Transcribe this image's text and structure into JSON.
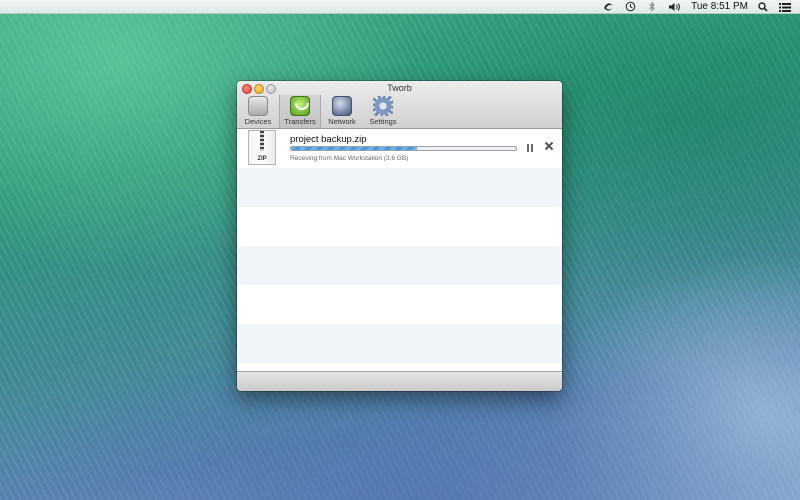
{
  "menubar": {
    "clock": "Tue 8:51 PM",
    "status_icons": [
      "tworb-icon",
      "time-machine-icon",
      "bluetooth-icon",
      "volume-icon"
    ],
    "right_icons": [
      "spotlight-icon",
      "notification-center-icon"
    ]
  },
  "window": {
    "title": "Tworb",
    "toolbar": {
      "devices": "Devices",
      "transfers": "Transfers",
      "network": "Network",
      "settings": "Settings",
      "selected": "Transfers"
    },
    "transfers": [
      {
        "filename": "project backup.zip",
        "file_type": "ZIP",
        "progress": 0.56,
        "status": "Receving from Mac Workstation (3.6 GB)"
      }
    ]
  },
  "colors": {
    "progress_fill": "#4c97dc",
    "row_alt": "#f1f5fa"
  }
}
